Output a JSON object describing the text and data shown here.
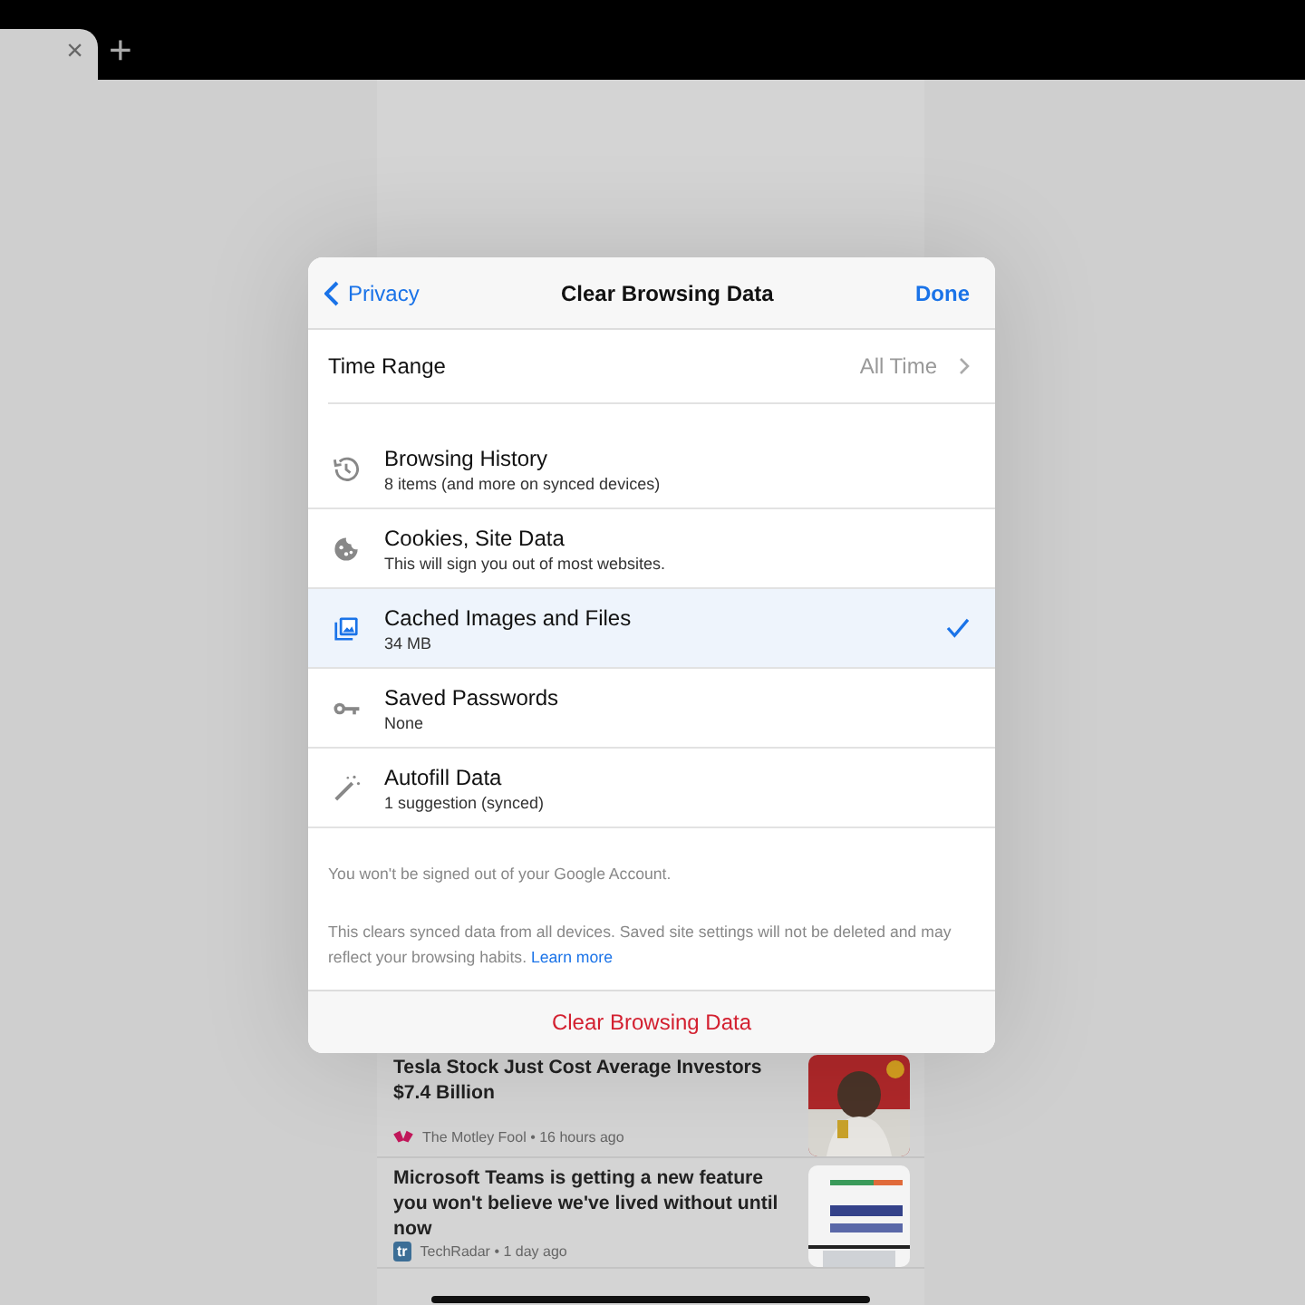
{
  "browser_tab": {
    "close": "×",
    "new_tab": "+"
  },
  "feed": [
    {
      "title": "Tesla Stock Just Cost Average Investors $7.4 Billion",
      "meta": "The Motley Fool • 16 hours ago"
    },
    {
      "title": "Microsoft Teams is getting a new feature you won't believe we've lived without until now",
      "meta": "TechRadar • 1 day ago",
      "logo_text": "tr"
    }
  ],
  "dialog": {
    "back": "Privacy",
    "title": "Clear Browsing Data",
    "done": "Done",
    "time_range": {
      "label": "Time Range",
      "value": "All Time"
    },
    "items": [
      {
        "title": "Browsing History",
        "subtitle": "8 items (and more on synced devices)",
        "selected": false
      },
      {
        "title": "Cookies, Site Data",
        "subtitle": "This will sign you out of most websites.",
        "selected": false
      },
      {
        "title": "Cached Images and Files",
        "subtitle": "34 MB",
        "selected": true
      },
      {
        "title": "Saved Passwords",
        "subtitle": "None",
        "selected": false
      },
      {
        "title": "Autofill Data",
        "subtitle": "1 suggestion (synced)",
        "selected": false
      }
    ],
    "note": "You won't be signed out of your Google Account.",
    "info": {
      "text": "This clears synced data from all devices. Saved site settings will not be deleted and may reflect your browsing habits.",
      "link": "Learn more"
    },
    "clear_button": "Clear Browsing Data"
  }
}
